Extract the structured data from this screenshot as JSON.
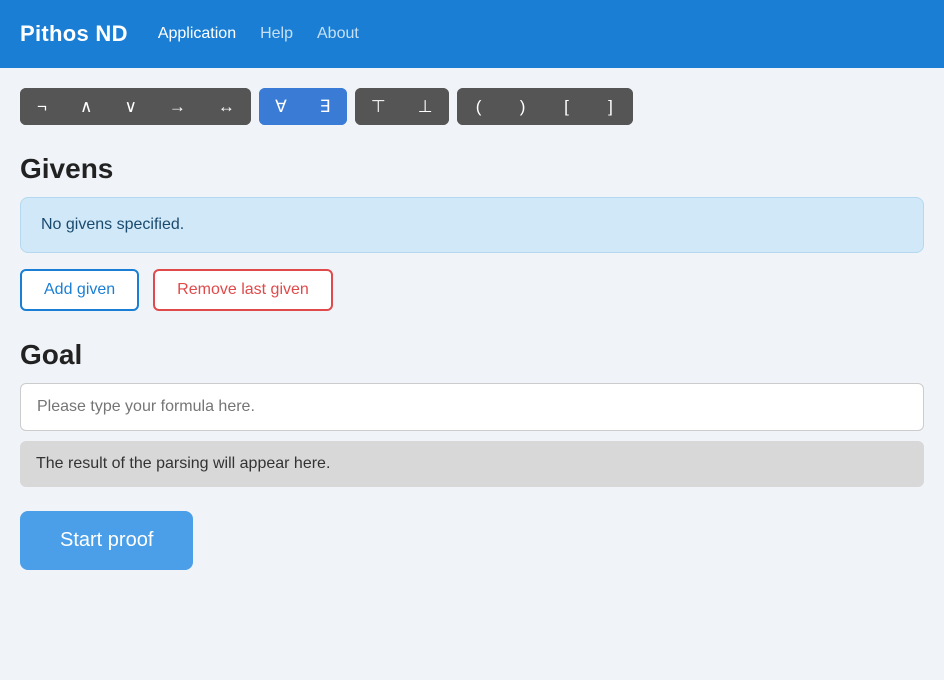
{
  "header": {
    "brand": "Pithos ND",
    "nav": [
      {
        "label": "Application",
        "muted": false
      },
      {
        "label": "Help",
        "muted": true
      },
      {
        "label": "About",
        "muted": true
      }
    ]
  },
  "toolbar": {
    "groups": [
      {
        "style": "dark",
        "symbols": [
          "¬",
          "∧",
          "∨",
          "→",
          "↔"
        ]
      },
      {
        "style": "blue",
        "symbols": [
          "∀",
          "∃"
        ]
      },
      {
        "style": "dark",
        "symbols": [
          "⊤",
          "⊥"
        ]
      },
      {
        "style": "dark",
        "symbols": [
          "(",
          ")",
          "[",
          "]"
        ]
      }
    ]
  },
  "givens": {
    "title": "Givens",
    "empty_message": "No givens specified.",
    "add_button": "Add given",
    "remove_button": "Remove last given"
  },
  "goal": {
    "title": "Goal",
    "input_placeholder": "Please type your formula here.",
    "parse_result": "The result of the parsing will appear here."
  },
  "start_proof_button": "Start proof"
}
